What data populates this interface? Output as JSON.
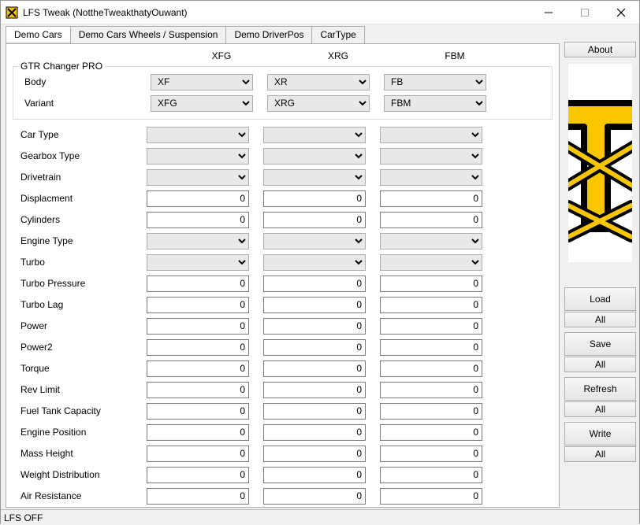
{
  "window": {
    "title": "LFS Tweak (NottheTweakthatyOuwant)"
  },
  "tabs": [
    "Demo Cars",
    "Demo Cars Wheels / Suspension",
    "Demo DriverPos",
    "CarType"
  ],
  "active_tab": 0,
  "columns": [
    "XFG",
    "XRG",
    "FBM"
  ],
  "group_title": "GTR Changer PRO",
  "group_rows": [
    {
      "label": "Body",
      "type": "select",
      "values": [
        "XF",
        "XR",
        "FB"
      ]
    },
    {
      "label": "Variant",
      "type": "select",
      "values": [
        "XFG",
        "XRG",
        "FBM"
      ]
    }
  ],
  "rows": [
    {
      "label": "Car Type",
      "type": "select",
      "values": [
        "",
        "",
        ""
      ]
    },
    {
      "label": "Gearbox Type",
      "type": "select",
      "values": [
        "",
        "",
        ""
      ]
    },
    {
      "label": "Drivetrain",
      "type": "select",
      "values": [
        "",
        "",
        ""
      ]
    },
    {
      "label": "Displacment",
      "type": "input",
      "values": [
        "0",
        "0",
        "0"
      ]
    },
    {
      "label": "Cylinders",
      "type": "input",
      "values": [
        "0",
        "0",
        "0"
      ]
    },
    {
      "label": "Engine Type",
      "type": "select",
      "values": [
        "",
        "",
        ""
      ]
    },
    {
      "label": "Turbo",
      "type": "select",
      "values": [
        "",
        "",
        ""
      ]
    },
    {
      "label": "Turbo Pressure",
      "type": "input",
      "values": [
        "0",
        "0",
        "0"
      ]
    },
    {
      "label": "Turbo Lag",
      "type": "input",
      "values": [
        "0",
        "0",
        "0"
      ]
    },
    {
      "label": "Power",
      "type": "input",
      "values": [
        "0",
        "0",
        "0"
      ]
    },
    {
      "label": "Power2",
      "type": "input",
      "values": [
        "0",
        "0",
        "0"
      ]
    },
    {
      "label": "Torque",
      "type": "input",
      "values": [
        "0",
        "0",
        "0"
      ]
    },
    {
      "label": "Rev Limit",
      "type": "input",
      "values": [
        "0",
        "0",
        "0"
      ]
    },
    {
      "label": "Fuel Tank Capacity",
      "type": "input",
      "values": [
        "0",
        "0",
        "0"
      ]
    },
    {
      "label": "Engine Position",
      "type": "input",
      "values": [
        "0",
        "0",
        "0"
      ]
    },
    {
      "label": "Mass Height",
      "type": "input",
      "values": [
        "0",
        "0",
        "0"
      ]
    },
    {
      "label": "Weight Distribution",
      "type": "input",
      "values": [
        "0",
        "0",
        "0"
      ]
    },
    {
      "label": "Air Resistance",
      "type": "input",
      "values": [
        "0",
        "0",
        "0"
      ]
    }
  ],
  "sidebar": {
    "about": "About",
    "buttons": [
      {
        "main": "Load",
        "sub": "All"
      },
      {
        "main": "Save",
        "sub": "All"
      },
      {
        "main": "Refresh",
        "sub": "All"
      },
      {
        "main": "Write",
        "sub": "All"
      }
    ]
  },
  "status": "LFS OFF"
}
